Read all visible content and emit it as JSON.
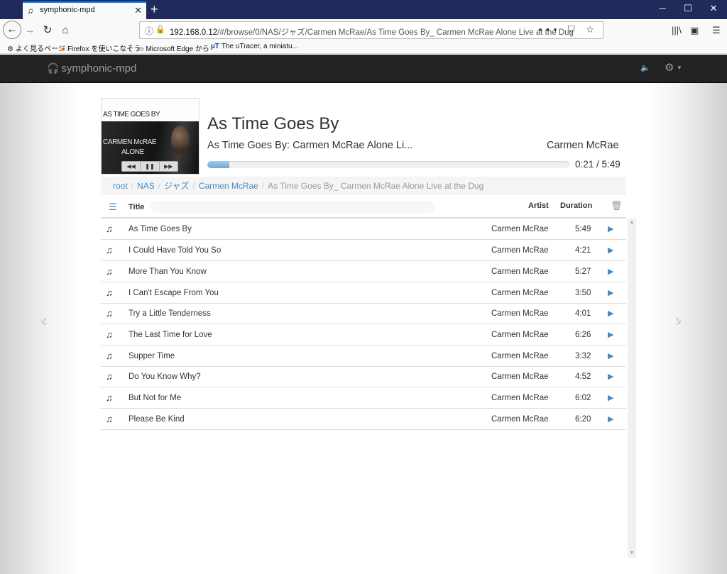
{
  "browser": {
    "tab_title": "symphonic-mpd",
    "url_host": "192.168.0.12",
    "url_path": "/#/browse/0/NAS/ジャズ/Carmen McRae/As Time Goes By_ Carmen McRae Alone Live at the Dug",
    "url_actions": "••• ⛉ ☆",
    "bookmarks": [
      "よく見るページ",
      "Firefox を使いこなそう",
      "Microsoft Edge から",
      "The uTracer, a miniatu..."
    ]
  },
  "app": {
    "brand": "symphonic-mpd"
  },
  "now_playing": {
    "cover_title": "AS TIME GOES BY",
    "cover_artist": "CARMEN McRAE",
    "cover_album": "ALONE",
    "title": "As Time Goes By",
    "album": "As Time Goes By: Carmen McRae Alone Li...",
    "artist": "Carmen McRae",
    "time": "0:21 / 5:49",
    "progress_fraction": 0.06
  },
  "breadcrumb": [
    "root",
    "NAS",
    "ジャズ",
    "Carmen McRae",
    "As Time Goes By_ Carmen McRae Alone Live at the Dug"
  ],
  "columns": {
    "title": "Title",
    "artist": "Artist",
    "duration": "Duration"
  },
  "tracks": [
    {
      "title": "As Time Goes By",
      "artist": "Carmen McRae",
      "duration": "5:49"
    },
    {
      "title": "I Could Have Told You So",
      "artist": "Carmen McRae",
      "duration": "4:21"
    },
    {
      "title": "More Than You Know",
      "artist": "Carmen McRae",
      "duration": "5:27"
    },
    {
      "title": "I Can't Escape From You",
      "artist": "Carmen McRae",
      "duration": "3:50"
    },
    {
      "title": "Try a Little Tenderness",
      "artist": "Carmen McRae",
      "duration": "4:01"
    },
    {
      "title": "The Last Time for Love",
      "artist": "Carmen McRae",
      "duration": "6:26"
    },
    {
      "title": "Supper Time",
      "artist": "Carmen McRae",
      "duration": "3:32"
    },
    {
      "title": "Do You Know Why?",
      "artist": "Carmen McRae",
      "duration": "4:52"
    },
    {
      "title": "But Not for Me",
      "artist": "Carmen McRae",
      "duration": "6:02"
    },
    {
      "title": "Please Be Kind",
      "artist": "Carmen McRae",
      "duration": "6:20"
    }
  ],
  "colors": {
    "navbar": "#222222",
    "link": "#428bca",
    "titlebar": "#1f2b5b"
  }
}
